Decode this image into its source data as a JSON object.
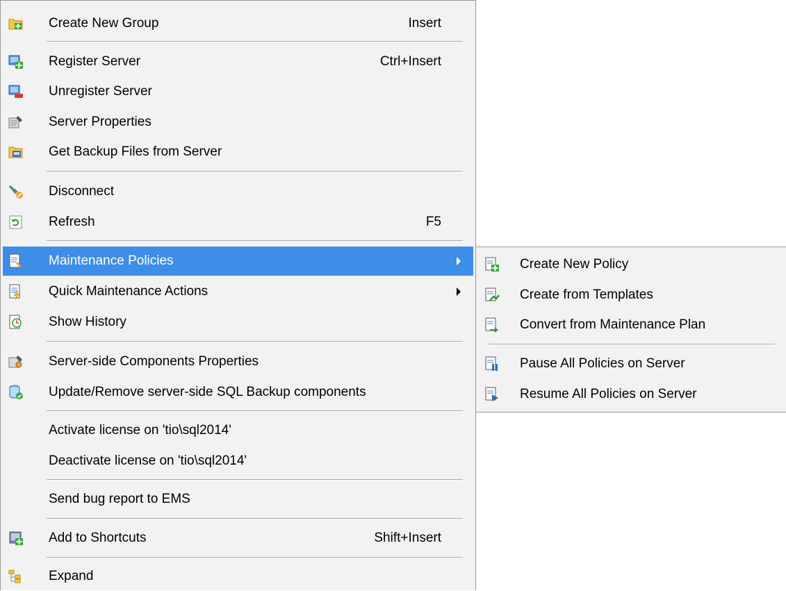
{
  "main_menu": {
    "items": [
      {
        "label": "Create New Group",
        "shortcut": "Insert",
        "icon": "folder-add-icon"
      },
      {
        "label": "Register Server",
        "shortcut": "Ctrl+Insert",
        "icon": "server-add-icon"
      },
      {
        "label": "Unregister Server",
        "shortcut": "",
        "icon": "server-remove-icon"
      },
      {
        "label": "Server Properties",
        "shortcut": "",
        "icon": "server-properties-icon"
      },
      {
        "label": "Get Backup Files from Server",
        "shortcut": "",
        "icon": "backup-files-icon"
      },
      {
        "label": "Disconnect",
        "shortcut": "",
        "icon": "disconnect-plug-icon"
      },
      {
        "label": "Refresh",
        "shortcut": "F5",
        "icon": "refresh-icon"
      },
      {
        "label": "Maintenance Policies",
        "shortcut": "",
        "icon": "maintenance-policies-icon"
      },
      {
        "label": "Quick Maintenance Actions",
        "shortcut": "",
        "icon": "quick-maintenance-icon"
      },
      {
        "label": "Show History",
        "shortcut": "",
        "icon": "history-icon"
      },
      {
        "label": "Server-side Components Properties",
        "shortcut": "",
        "icon": "components-properties-icon"
      },
      {
        "label": "Update/Remove server-side SQL Backup components",
        "shortcut": "",
        "icon": "database-check-icon"
      },
      {
        "label": "Activate license on 'tio\\sql2014'",
        "shortcut": ""
      },
      {
        "label": "Deactivate license on 'tio\\sql2014'",
        "shortcut": ""
      },
      {
        "label": "Send bug report to EMS",
        "shortcut": ""
      },
      {
        "label": "Add to Shortcuts",
        "shortcut": "Shift+Insert",
        "icon": "add-shortcut-icon"
      },
      {
        "label": "Expand",
        "shortcut": "",
        "icon": "expand-tree-icon"
      }
    ]
  },
  "sub_menu": {
    "items": [
      {
        "label": "Create New Policy",
        "icon": "policy-add-icon"
      },
      {
        "label": "Create from Templates",
        "icon": "policy-template-icon"
      },
      {
        "label": "Convert from Maintenance Plan",
        "icon": "policy-convert-icon"
      },
      {
        "label": "Pause All Policies on Server",
        "icon": "policy-pause-icon"
      },
      {
        "label": "Resume All Policies on Server",
        "icon": "policy-resume-icon"
      }
    ]
  },
  "colors": {
    "highlight": "#3d8ee8",
    "menu_bg": "#f2f2f2",
    "separator": "#a8a8a8"
  }
}
